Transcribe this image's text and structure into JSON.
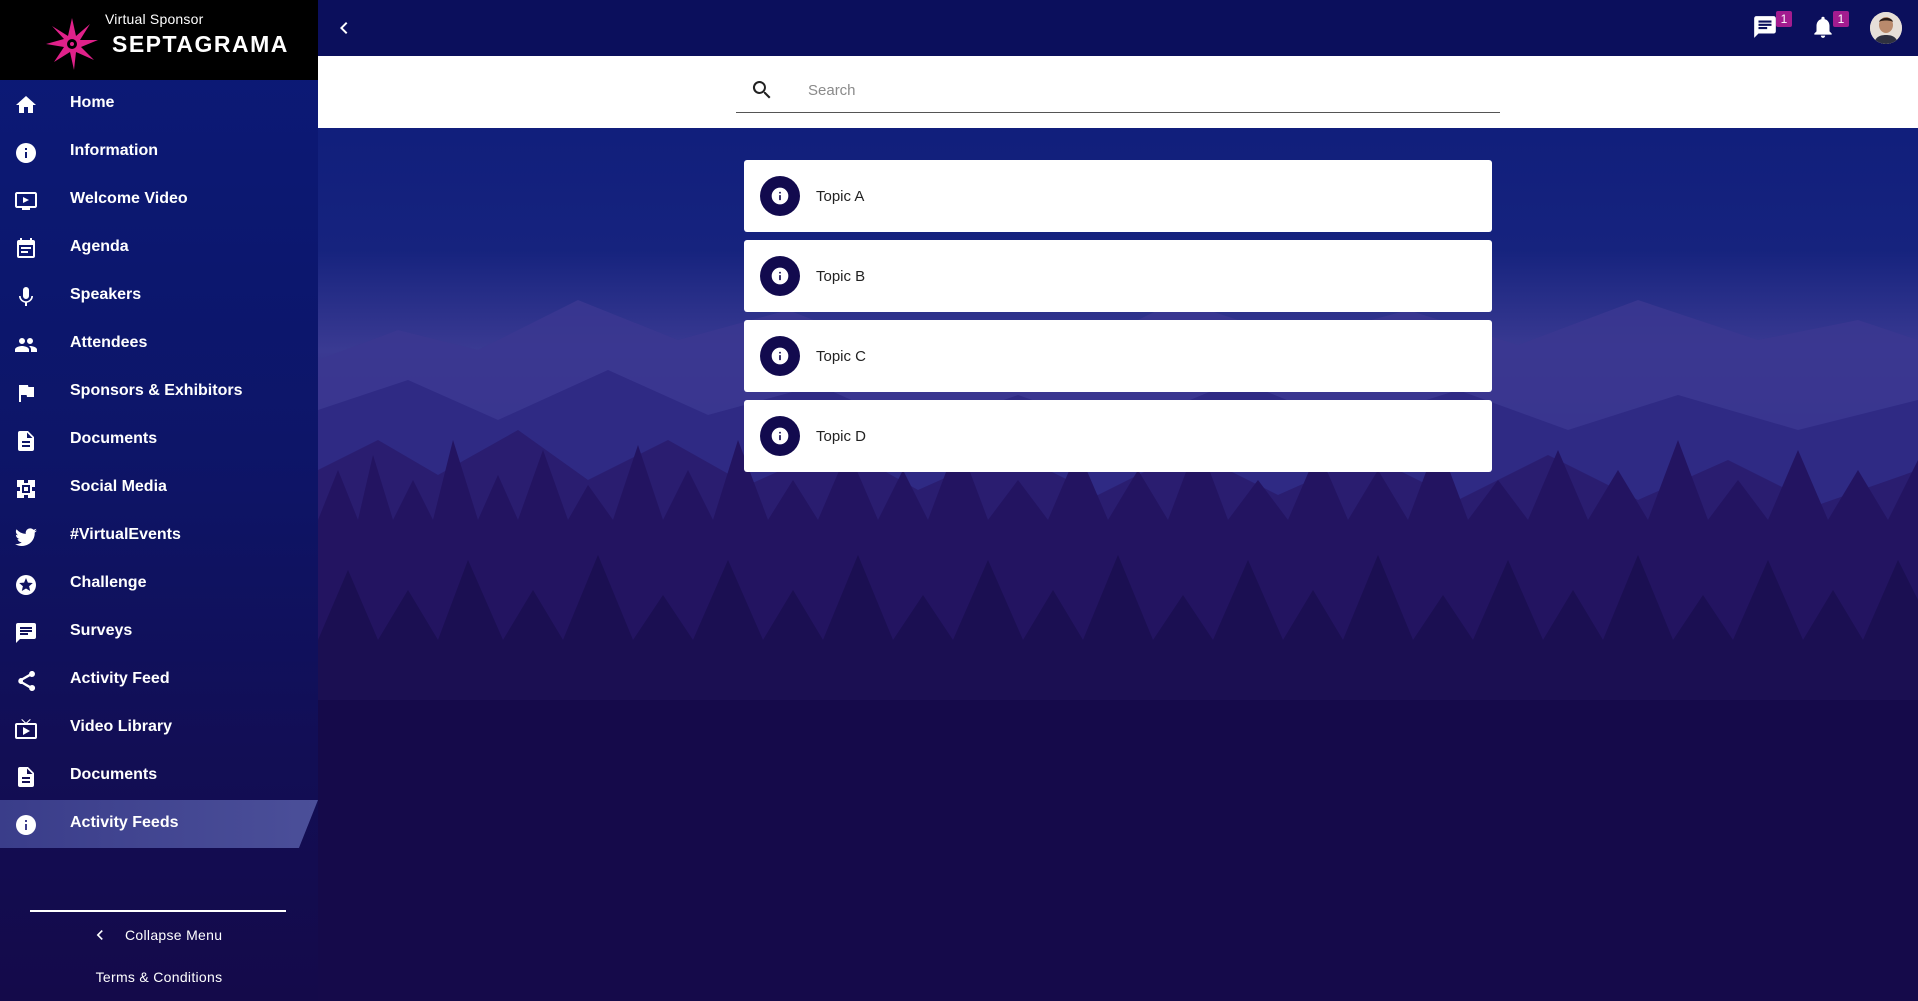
{
  "brand": {
    "subtitle": "Virtual Sponsor",
    "name": "SEPTAGRAMA",
    "logo_icon": "star-logo-icon",
    "accent_color": "#e0218a"
  },
  "nav": {
    "items": [
      {
        "label": "Home",
        "icon": "home-icon"
      },
      {
        "label": "Information",
        "icon": "info-icon"
      },
      {
        "label": "Welcome Video",
        "icon": "video-play-icon"
      },
      {
        "label": "Agenda",
        "icon": "calendar-icon"
      },
      {
        "label": "Speakers",
        "icon": "microphone-icon"
      },
      {
        "label": "Attendees",
        "icon": "people-icon"
      },
      {
        "label": "Sponsors & Exhibitors",
        "icon": "flag-icon"
      },
      {
        "label": "Documents",
        "icon": "document-icon"
      },
      {
        "label": "Social Media",
        "icon": "social-icon"
      },
      {
        "label": "#VirtualEvents",
        "icon": "twitter-icon"
      },
      {
        "label": "Challenge",
        "icon": "star-badge-icon"
      },
      {
        "label": "Surveys",
        "icon": "survey-icon"
      },
      {
        "label": "Activity Feed",
        "icon": "share-icon"
      },
      {
        "label": "Video Library",
        "icon": "video-library-icon"
      },
      {
        "label": "Documents",
        "icon": "document-icon"
      },
      {
        "label": "Activity Feeds",
        "icon": "info-icon",
        "active": true
      }
    ],
    "collapse_label": "Collapse Menu",
    "terms_label": "Terms & Conditions"
  },
  "topbar": {
    "back_icon": "chevron-left-icon",
    "chat_badge": "1",
    "notification_badge": "1",
    "badge_color": "#a31c8f"
  },
  "search": {
    "placeholder": "Search",
    "value": ""
  },
  "topics": [
    {
      "label": "Topic A"
    },
    {
      "label": "Topic B"
    },
    {
      "label": "Topic C"
    },
    {
      "label": "Topic D"
    }
  ]
}
